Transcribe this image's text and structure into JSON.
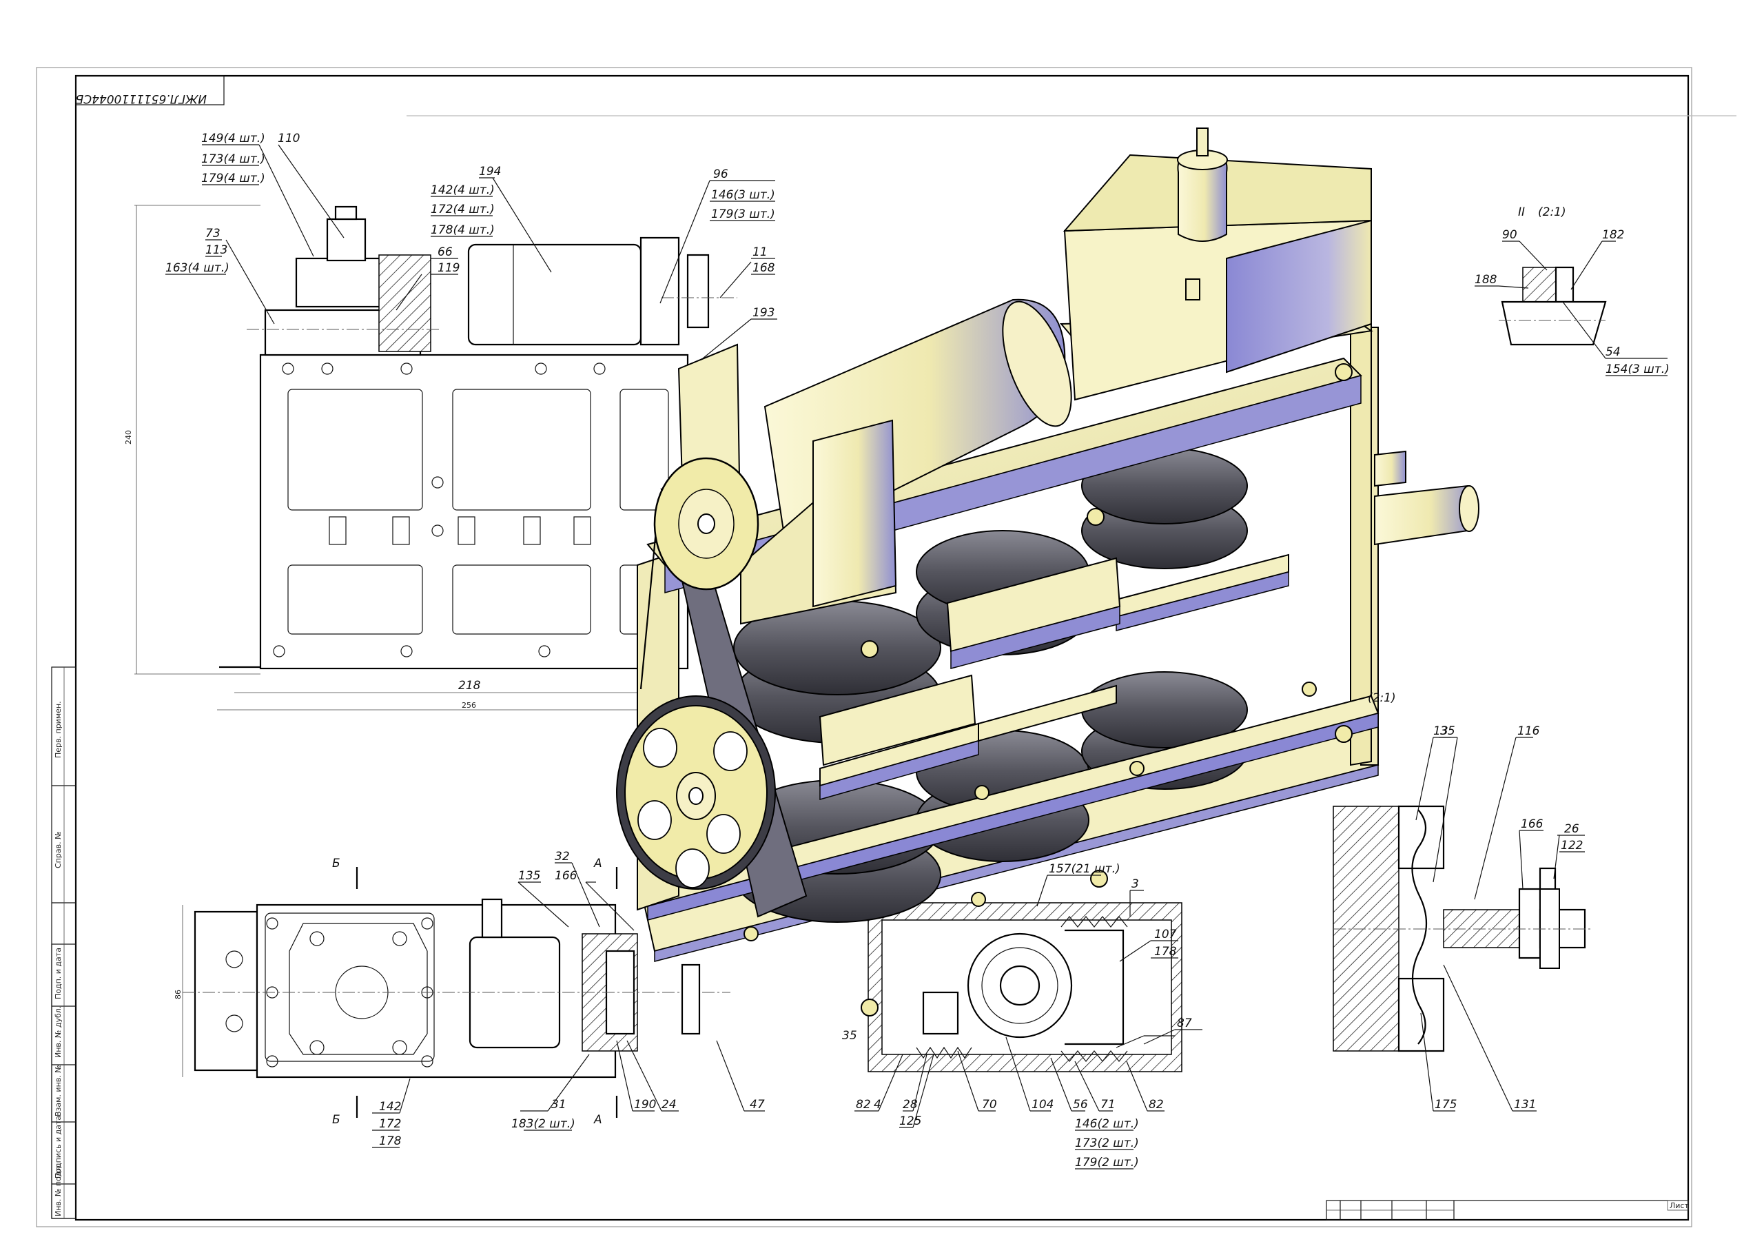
{
  "stamp": {
    "drawing_code": "ИЖГЛ.6511110044СБ",
    "sheet_label": "Лист"
  },
  "side_columns": [
    "Перв. примен.",
    "Справ. №",
    "Подп. и дата",
    "Инв. № дубл.",
    "Взам. инв. №",
    "Подпись и дата",
    "Инв. № подл."
  ],
  "dimensions": {
    "height_240": "240",
    "width_218": "218",
    "width_256": "256",
    "depth_86": "86"
  },
  "section_marks": {
    "b_top": "Б",
    "b_bottom": "Б",
    "a_top": "А",
    "a_bottom": "А"
  },
  "views": {
    "detail_II": "II",
    "detail_II_scale": "(2:1)",
    "detail_right_scale": "(2:1)"
  },
  "labels": {
    "p149": "149(4 шт.)",
    "p173": "173(4 шт.)",
    "p179": "179(4 шт.)",
    "p110": "110",
    "p73": "73",
    "p113": "113",
    "p163": "163(4 шт.)",
    "p66": "66",
    "p119": "119",
    "p194": "194",
    "p142": "142(4 шт.)",
    "p172": "172(4 шт.)",
    "p178": "178(4 шт.)",
    "p96": "96",
    "p146": "146(3 шт.)",
    "p179b": "179(3 шт.)",
    "p11": "11",
    "p168": "168",
    "p193": "193",
    "p90": "90",
    "p182": "182",
    "p188": "188",
    "p54": "54",
    "p154": "154(3 шт.)",
    "p13": "13",
    "p35": "35",
    "p116": "116",
    "p166": "166",
    "p26": "26",
    "p122": "122",
    "p175": "175",
    "p131": "131",
    "p32": "32",
    "p166b": "166",
    "p135": "135",
    "p31": "31",
    "p183": "183(2 шт.)",
    "p190": "190",
    "p24": "24",
    "p47": "47",
    "p142b": "142",
    "p172b": "172",
    "p178b": "178",
    "p157": "157(21 шт.)",
    "p3": "3",
    "p107": "107",
    "p178c": "178",
    "p87": "87",
    "p82": "82",
    "p4": "4",
    "p28": "28",
    "p125": "125",
    "p70": "70",
    "p104": "104",
    "p56": "56",
    "p71": "71",
    "p82b": "82",
    "p146b": "146(2 шт.)",
    "p173b": "173(2 шт.)",
    "p179c": "179(2 шт.)",
    "p35b": "35"
  },
  "colors": {
    "body_yellow": "#f4f0c2",
    "shade_blue": "#7f7ecb",
    "coil_dark": "#5c5c66",
    "outline": "#000000"
  }
}
